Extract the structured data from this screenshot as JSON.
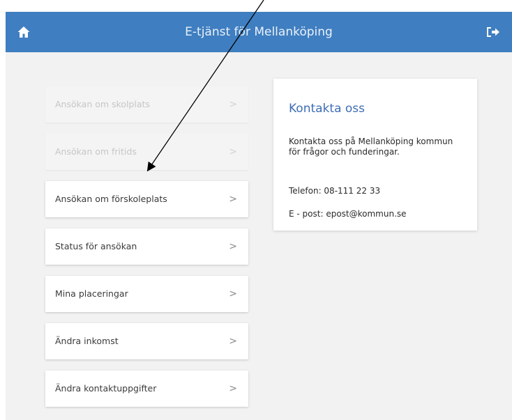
{
  "header": {
    "title": "E-tjänst för Mellanköping",
    "home_icon": "home-icon",
    "logout_icon": "logout-icon",
    "color": "#3f7ec0"
  },
  "menu": {
    "items": [
      {
        "label": "Ansökan om skolplats",
        "chevron": ">",
        "disabled": true
      },
      {
        "label": "Ansökan om fritids",
        "chevron": ">",
        "disabled": true
      },
      {
        "label": "Ansökan om förskoleplats",
        "chevron": ">",
        "disabled": false
      },
      {
        "label": "Status för ansökan",
        "chevron": ">",
        "disabled": false
      },
      {
        "label": "Mina placeringar",
        "chevron": ">",
        "disabled": false
      },
      {
        "label": "Ändra inkomst",
        "chevron": ">",
        "disabled": false
      },
      {
        "label": "Ändra kontaktuppgifter",
        "chevron": ">",
        "disabled": false
      }
    ]
  },
  "contact": {
    "title": "Kontakta oss",
    "text": "Kontakta oss på Mellanköping kommun för frågor och funderingar.",
    "phone": "Telefon: 08-111 22 33",
    "email": "E - post: epost@kommun.se",
    "title_color": "#3f6db5"
  }
}
